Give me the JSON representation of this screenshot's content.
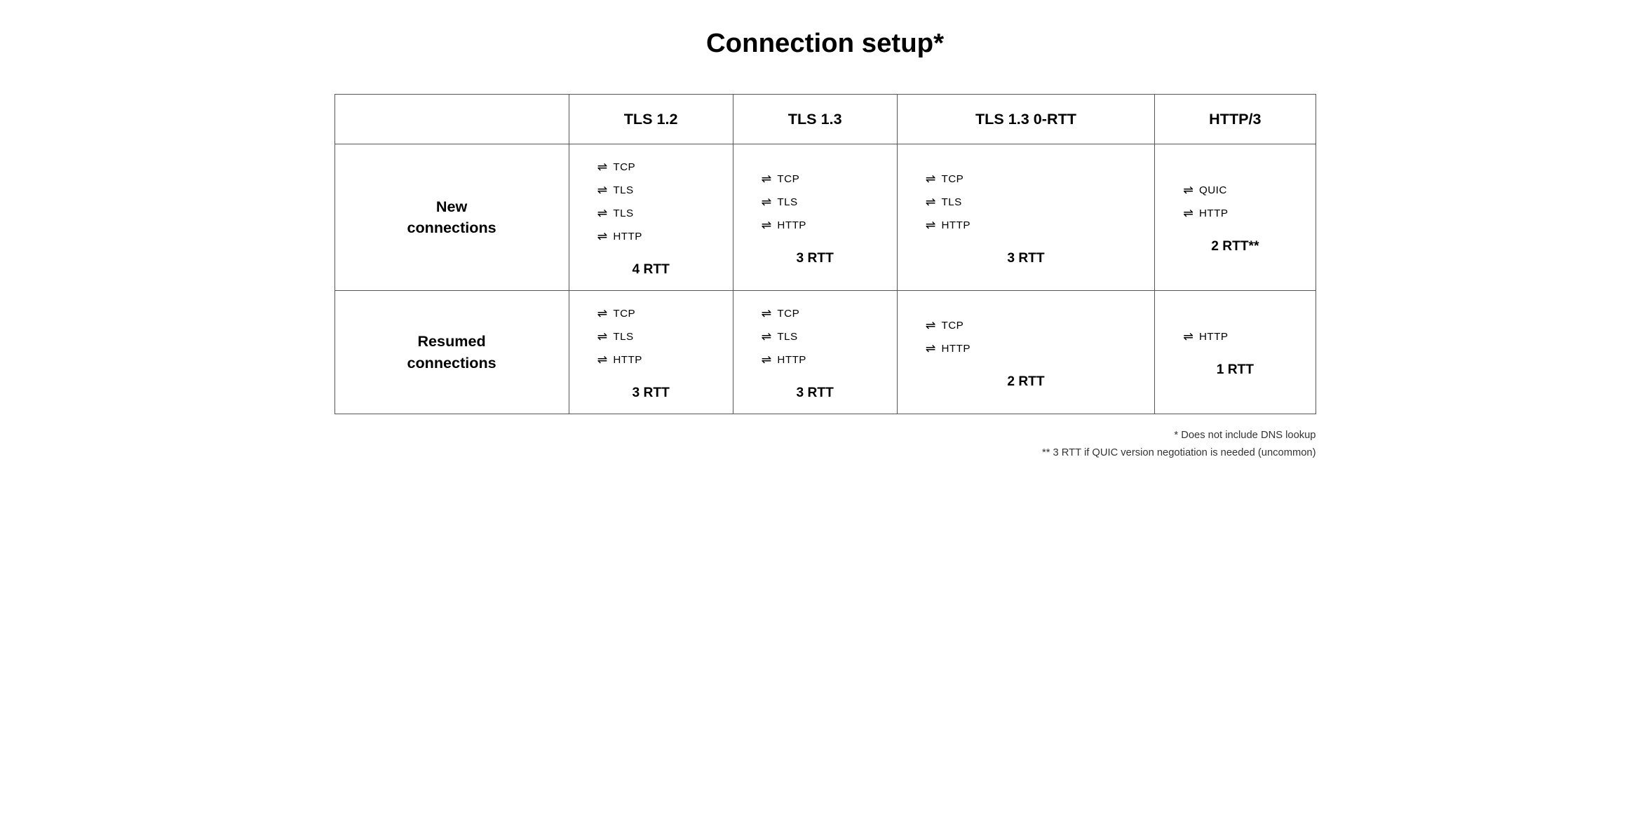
{
  "title": "Connection setup*",
  "columns": [
    "",
    "TLS 1.2",
    "TLS 1.3",
    "TLS 1.3 0-RTT",
    "HTTP/3"
  ],
  "rows": [
    {
      "header": "New\nconnections",
      "cells": [
        {
          "protocols": [
            "TCP",
            "TLS",
            "TLS",
            "HTTP"
          ],
          "rtt": "4 RTT"
        },
        {
          "protocols": [
            "TCP",
            "TLS",
            "HTTP"
          ],
          "rtt": "3 RTT"
        },
        {
          "protocols": [
            "TCP",
            "TLS",
            "HTTP"
          ],
          "rtt": "3 RTT"
        },
        {
          "protocols": [
            "QUIC",
            "HTTP"
          ],
          "rtt": "2 RTT**"
        }
      ]
    },
    {
      "header": "Resumed\nconnections",
      "cells": [
        {
          "protocols": [
            "TCP",
            "TLS",
            "HTTP"
          ],
          "rtt": "3 RTT"
        },
        {
          "protocols": [
            "TCP",
            "TLS",
            "HTTP"
          ],
          "rtt": "3 RTT"
        },
        {
          "protocols": [
            "TCP",
            "HTTP"
          ],
          "rtt": "2 RTT"
        },
        {
          "protocols": [
            "HTTP"
          ],
          "rtt": "1 RTT"
        }
      ]
    }
  ],
  "footnotes": [
    "* Does not include DNS lookup",
    "** 3 RTT if QUIC version negotiation is needed (uncommon)"
  ]
}
